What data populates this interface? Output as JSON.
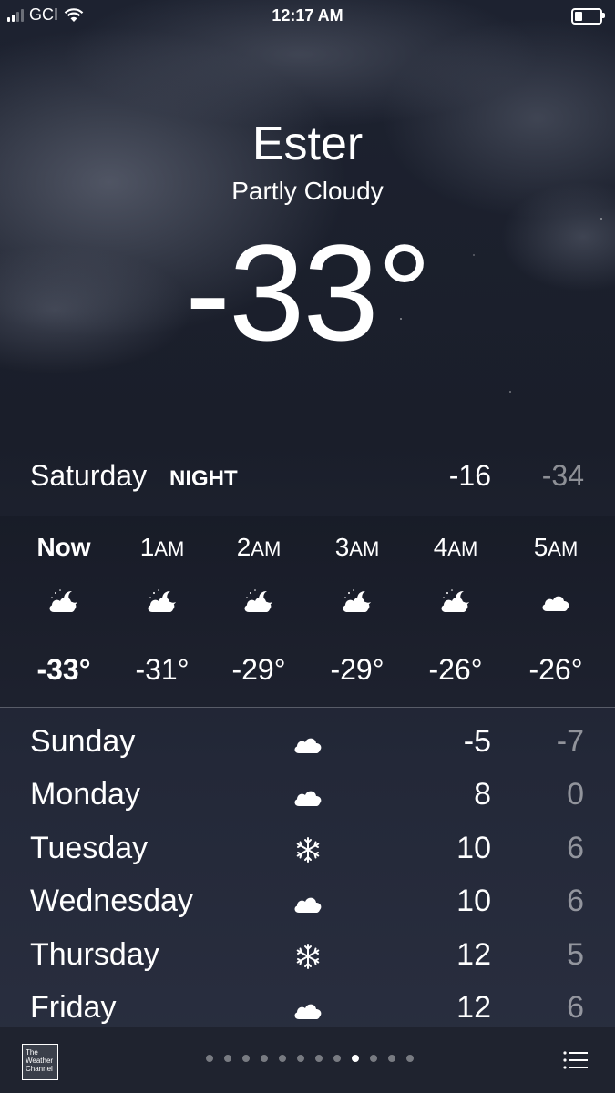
{
  "status_bar": {
    "carrier": "GCI",
    "time": "12:17 AM",
    "signal_bars": 2,
    "signal_bars_total": 4,
    "battery_level": 0.25,
    "icons": [
      "signal-icon",
      "wifi-icon",
      "battery-icon"
    ]
  },
  "location": {
    "city": "Ester",
    "condition": "Partly Cloudy",
    "temperature": "-33°"
  },
  "today": {
    "day": "Saturday",
    "period": "NIGHT",
    "high": "-16",
    "low": "-34"
  },
  "hourly": [
    {
      "time": "Now",
      "icon": "partly-cloudy-night-icon",
      "temp": "-33°",
      "bold": true
    },
    {
      "time": "1AM",
      "icon": "partly-cloudy-night-icon",
      "temp": "-31°"
    },
    {
      "time": "2AM",
      "icon": "partly-cloudy-night-icon",
      "temp": "-29°"
    },
    {
      "time": "3AM",
      "icon": "partly-cloudy-night-icon",
      "temp": "-29°"
    },
    {
      "time": "4AM",
      "icon": "partly-cloudy-night-icon",
      "temp": "-26°"
    },
    {
      "time": "5AM",
      "icon": "cloud-icon",
      "temp": "-26°"
    }
  ],
  "daily": [
    {
      "day": "Sunday",
      "icon": "cloud-icon",
      "high": "-5",
      "low": "-7"
    },
    {
      "day": "Monday",
      "icon": "cloud-icon",
      "high": "8",
      "low": "0"
    },
    {
      "day": "Tuesday",
      "icon": "snowflake-icon",
      "high": "10",
      "low": "6"
    },
    {
      "day": "Wednesday",
      "icon": "cloud-icon",
      "high": "10",
      "low": "6"
    },
    {
      "day": "Thursday",
      "icon": "snowflake-icon",
      "high": "12",
      "low": "5"
    },
    {
      "day": "Friday",
      "icon": "cloud-icon",
      "high": "12",
      "low": "6"
    }
  ],
  "bottom_bar": {
    "logo_text": [
      "The",
      "Weather",
      "Channel"
    ],
    "page_count": 12,
    "active_page": 8
  }
}
